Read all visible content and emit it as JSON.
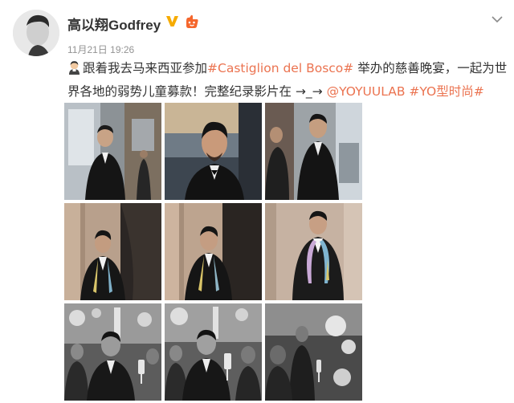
{
  "post": {
    "author": {
      "name": "高以翔Godfrey"
    },
    "timestamp": "11月21日 19:26",
    "text": {
      "intro": "跟着我去马来西亚参加",
      "hashtag1": "#Castiglion del Bosco#",
      "middle": " 举办的慈善晚宴，一起为世界各地的弱势儿童募款！完整纪录影片在 →_→ ",
      "mention": "@YOYUULAB",
      "space": " ",
      "hashtag2": "#YO型时尚#"
    },
    "icons": {
      "verified": "verified-v-icon",
      "member": "member-badge-icon",
      "emoji": "man-face-emoji-icon",
      "menu": "chevron-down-icon"
    },
    "colors": {
      "link": "#eb7350",
      "verified": "#f6ab00",
      "text": "#333333",
      "meta": "#939393"
    },
    "photos": [
      "photo-1",
      "photo-2",
      "photo-3",
      "photo-4",
      "photo-5",
      "photo-6",
      "photo-7",
      "photo-8",
      "photo-9"
    ]
  }
}
